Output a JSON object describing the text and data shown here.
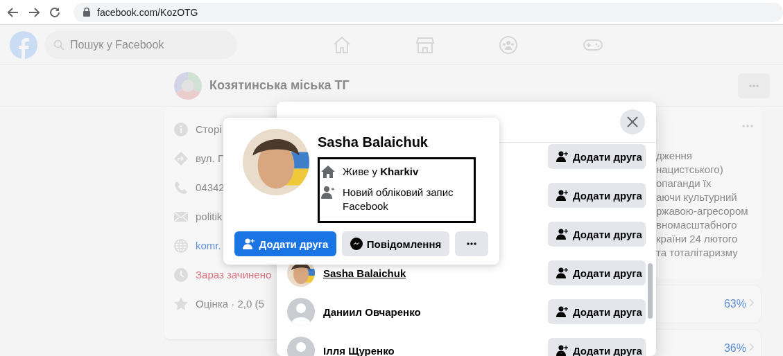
{
  "browser": {
    "url": "facebook.com/KozOTG"
  },
  "header": {
    "search_placeholder": "Пошук у Facebook"
  },
  "page": {
    "title": "Козятинська міська ТГ"
  },
  "about": [
    {
      "kind": "info",
      "text": "Сторі"
    },
    {
      "kind": "address",
      "text": "вул. Г"
    },
    {
      "kind": "phone",
      "text": "04342"
    },
    {
      "kind": "email",
      "text": "politik"
    },
    {
      "kind": "website",
      "text": "komr."
    },
    {
      "kind": "hours",
      "text": "Зараз зачинено"
    },
    {
      "kind": "rating",
      "text": "Оцінка · 2,0 (5"
    }
  ],
  "right_card": {
    "lines": [
      "дження",
      "нацистського)",
      "опаганди їх",
      "аючи культурний",
      "ржавою-агресором",
      "вномасштабного",
      "країни 24 лютого",
      "та тоталітаризму"
    ],
    "polls": [
      {
        "value": "63%"
      },
      {
        "value": "36%"
      }
    ]
  },
  "dialog": {
    "rows": [
      {
        "button": "Додати друга"
      },
      {
        "button": "Додати друга"
      },
      {
        "button": "Додати друга"
      },
      {
        "name": "Sasha Balaichuk",
        "hovered": true,
        "button": "Додати друга"
      },
      {
        "avatar": {
          "kind": "default"
        },
        "name": "Даниил Овчаренко",
        "hovered": false,
        "button": "Додати друга"
      },
      {
        "avatar": {
          "kind": "default"
        },
        "name": "Ілля Щуренко",
        "hovered": false,
        "button": "Додати друга"
      }
    ]
  },
  "hover_card": {
    "name": "Sasha Balaichuk",
    "details": [
      {
        "kind": "home",
        "text": "Живе у **Kharkiv**"
      },
      {
        "kind": "new_account",
        "text": "Новий обліковий запис Facebook"
      }
    ],
    "buttons": [
      {
        "kind": "primary",
        "label": "Додати друга"
      },
      {
        "kind": "messenger",
        "label": "Повідомлення"
      },
      {
        "kind": "more"
      }
    ]
  }
}
